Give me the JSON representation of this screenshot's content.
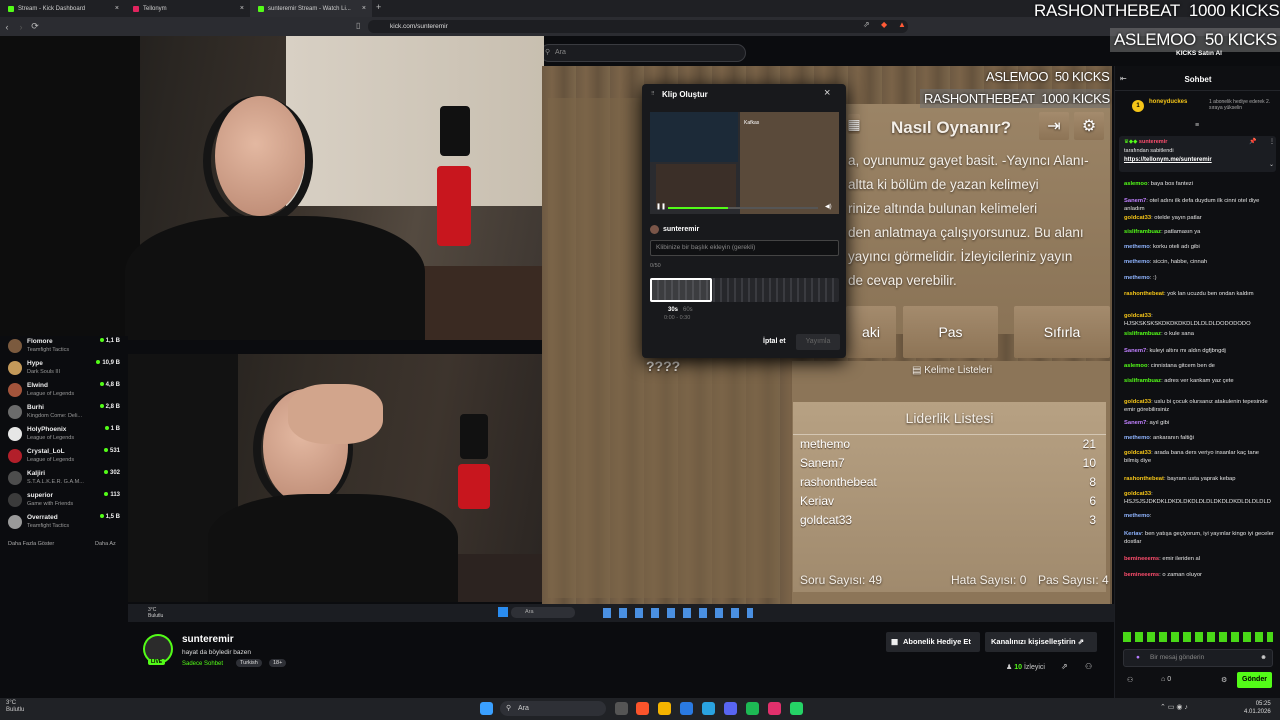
{
  "browser": {
    "tabs": [
      {
        "label": "Stream - Kick Dashboard",
        "color": "#53fc18"
      },
      {
        "label": "Tellonym",
        "color": "#e0245e"
      },
      {
        "label": "sunteremir Stream - Watch Li...",
        "color": "#53fc18"
      }
    ],
    "url": "kick.com/sunteremir",
    "search_placeholder": "Ara"
  },
  "alerts": {
    "a1_name": "RASHONTHEBEAT",
    "a1_value": "1000 KICKS",
    "a2_name": "ASLEMOO",
    "a2_value": "50 KICKS",
    "buy_kicks": "KICKS Satın Al"
  },
  "game": {
    "title": "Nasıl Oynanır?",
    "lines": [
      "a, oyunumuz gayet basit. -Yayıncı Alanı-",
      "altta ki bölüm de yazan kelimeyi",
      "rinize altında bulunan kelimeleri",
      "den anlatmaya çalışıyorsunuz. Bu alanı",
      "yayıncı görmelidir. İzleyicileriniz yayın",
      "de cevap verebilir."
    ],
    "btn_left": "aki",
    "btn_pass": "Pas",
    "btn_reset": "Sıfırla",
    "question": "????",
    "word_lists": "Kelime Listeleri",
    "leaderboard_title": "Liderlik Listesi",
    "leaderboard": [
      {
        "name": "methemo",
        "score": "21"
      },
      {
        "name": "Sanem7",
        "score": "10"
      },
      {
        "name": "rashonthebeat",
        "score": "8"
      },
      {
        "name": "Keriav",
        "score": "6"
      },
      {
        "name": "goldcat33",
        "score": "3"
      }
    ],
    "question_count": "Soru Sayısı: 49",
    "wrong_count": "Hata Sayısı: 0",
    "pass_count": "Pas Sayısı: 4"
  },
  "clip": {
    "title": "Klip Oluştur",
    "channel": "sunteremir",
    "title_placeholder": "Klibinize bir başlık ekleyin (gerekli)",
    "char_count": "0/50",
    "dur_30": "30s",
    "dur_60": "60s",
    "range": "0:00 - 0:30",
    "cancel": "İptal et",
    "publish": "Yayımla",
    "thumb_text": "Kafkas"
  },
  "live_list": {
    "items": [
      {
        "name": "Flomore",
        "game": "Teamfight Tactics",
        "viewers": "1,1 B",
        "color": "#7b5a3e"
      },
      {
        "name": "Hype",
        "game": "Dark Souls III",
        "viewers": "10,9 B",
        "color": "#c49a5a"
      },
      {
        "name": "Elwind",
        "game": "League of Legends",
        "viewers": "4,8 B",
        "color": "#a3543b"
      },
      {
        "name": "Burhi",
        "game": "Kingdom Come: Deli...",
        "viewers": "2,8 B",
        "color": "#6b6b6b"
      },
      {
        "name": "HolyPhoenix",
        "game": "League of Legends",
        "viewers": "1 B",
        "color": "#e6e6e6"
      },
      {
        "name": "Crystal_LoL",
        "game": "League of Legends",
        "viewers": "531",
        "color": "#b21f2a"
      },
      {
        "name": "Kaljiri",
        "game": "S.T.A.L.K.E.R. G.A.M...",
        "viewers": "302",
        "color": "#4d4d4d"
      },
      {
        "name": "superior",
        "game": "Game with Friends",
        "viewers": "113",
        "color": "#3b3b3b"
      },
      {
        "name": "Overrated",
        "game": "Teamfight Tactics",
        "viewers": "1,5 B",
        "color": "#9a9a9a"
      }
    ],
    "more": "Daha Fazla Göster",
    "less": "Daha Az"
  },
  "stream": {
    "streamer": "sunteremir",
    "title": "hayat da böyledir bazen",
    "tag_chat": "Sadece Sohbet",
    "tag_lang": "Turkish",
    "tag_age": "18+",
    "live": "LIVE",
    "gift_sub": "Abonelik Hediye Et",
    "customize": "Kanalınızı kişiselleştirin",
    "viewers": "10",
    "viewers_label": "İzleyici",
    "inner_weather": "3°C",
    "inner_weather_sub": "Bulutlu",
    "inner_search": "Ara"
  },
  "chat": {
    "header": "Sohbet",
    "sub_user": "honeyduckes",
    "sub_count": "1",
    "sub_text": "1 abonelik hediye ederek 2. sıraya yükselin",
    "pinned_user": "sunteremir",
    "pinned_label": "tarafından sabitlendi",
    "pinned_link": "https://tellonym.me/sunteremir",
    "messages": [
      {
        "user": "aslemoo",
        "color": "#53fc18",
        "text": "baya bos fantezi"
      },
      {
        "user": "Sanem7",
        "color": "#c080ff",
        "text": "otel adını ilk defa duydum ilk cinni otel diye anladım"
      },
      {
        "user": "goldcat33",
        "color": "#f5c518",
        "text": "otelde yayın patlar"
      },
      {
        "user": "sisliframbuaz",
        "color": "#53fc18",
        "text": "patlamasın ya"
      },
      {
        "user": "methemo",
        "color": "#8fb4ff",
        "text": "korku oteli adı gibi"
      },
      {
        "user": "methemo",
        "color": "#8fb4ff",
        "text": "siccin, habbe, cinnah"
      },
      {
        "user": "methemo",
        "color": "#8fb4ff",
        "text": ":)"
      },
      {
        "user": "rashonthebeat",
        "color": "#f5c518",
        "text": "yok lan ucuzdu ben ondan kaldım"
      },
      {
        "user": "goldcat33",
        "color": "#f5c518",
        "text": "HJSKSKSKSKDKDKDKDLDLDLDLDODODODO"
      },
      {
        "user": "sisliframbuaz",
        "color": "#53fc18",
        "text": "o kule sana"
      },
      {
        "user": "Sanem7",
        "color": "#c080ff",
        "text": "kuleyi altını mı aldın dgfjbngdj"
      },
      {
        "user": "aslemoo",
        "color": "#53fc18",
        "text": "cinnistana gitcem ben de"
      },
      {
        "user": "sisliframbuaz",
        "color": "#53fc18",
        "text": "adres ver kankam yaz çete"
      },
      {
        "user": "goldcat33",
        "color": "#f5c518",
        "text": "uslu bi çocuk olursanız atakulenin tepesinde emir görebilirsiniz"
      },
      {
        "user": "Sanem7",
        "color": "#c080ff",
        "text": "ayıl gibi"
      },
      {
        "user": "methemo",
        "color": "#8fb4ff",
        "text": "ankaranın faltiği"
      },
      {
        "user": "goldcat33",
        "color": "#f5c518",
        "text": "arada bana ders veriyo insanlar kaç tane bilmiş diye"
      },
      {
        "user": "rashonthebeat",
        "color": "#f5c518",
        "text": "bayram usta yaprak kebap"
      },
      {
        "user": "goldcat33",
        "color": "#f5c518",
        "text": "HSJSJSJDKDKLDKDLDKDLDLDLDKDLDKDLDLDLDLD"
      },
      {
        "user": "methemo",
        "color": "#8fb4ff",
        "text": ""
      },
      {
        "user": "Keriav",
        "color": "#8fb4ff",
        "text": "ben yatışa geçiyorum, iyi yayınlar kingo iyi geceler dostlar"
      },
      {
        "user": "bemineeems",
        "color": "#ff4d6d",
        "text": "emir ileriden al"
      },
      {
        "user": "bemineeems",
        "color": "#ff4d6d",
        "text": "o zaman oluyor"
      }
    ],
    "input_placeholder": "Bir mesaj gönderin",
    "points": "0",
    "send": "Gönder"
  },
  "taskbar": {
    "weather": "3°C",
    "weather_sub": "Bulutlu",
    "search": "Ara",
    "time": "05:25",
    "date": "4.01.2026"
  },
  "colors": {
    "accent": "#53fc18",
    "bg": "#0b0c0f"
  }
}
